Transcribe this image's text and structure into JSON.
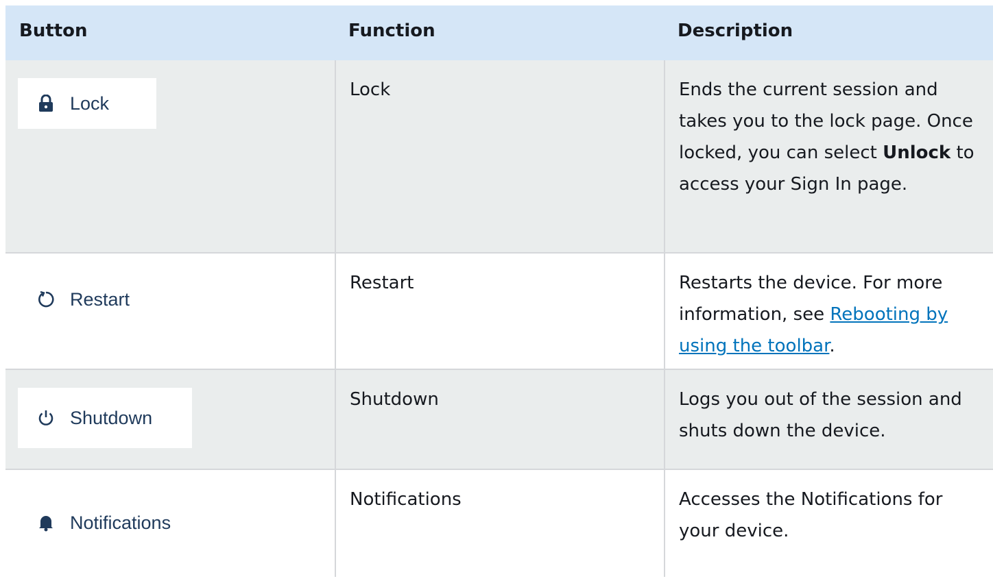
{
  "table": {
    "headers": [
      "Button",
      "Function",
      "Description"
    ],
    "rows": [
      {
        "button_icon": "lock-icon",
        "button_label": "Lock",
        "function": "Lock",
        "description_parts": {
          "before": "Ends the current session and takes you to the lock page. Once locked, you can select ",
          "bold": "Unlock",
          "after": " to access your Sign In page."
        }
      },
      {
        "button_icon": "restart-icon",
        "button_label": "Restart",
        "function": "Restart",
        "description_parts": {
          "before": "Restarts the device. For more information, see ",
          "link": "Rebooting by using the toolbar",
          "after": "."
        }
      },
      {
        "button_icon": "power-icon",
        "button_label": "Shutdown",
        "function": "Shutdown",
        "description": "Logs you out of the session and shuts down the device."
      },
      {
        "button_icon": "bell-icon",
        "button_label": "Notifications",
        "function": "Notifications",
        "description": "Accesses the Notifications for your device."
      }
    ]
  },
  "colors": {
    "header_bg": "#d5e6f7",
    "row_alt_bg": "#eaeded",
    "link": "#0073bb",
    "button_text": "#1f3a5b"
  }
}
